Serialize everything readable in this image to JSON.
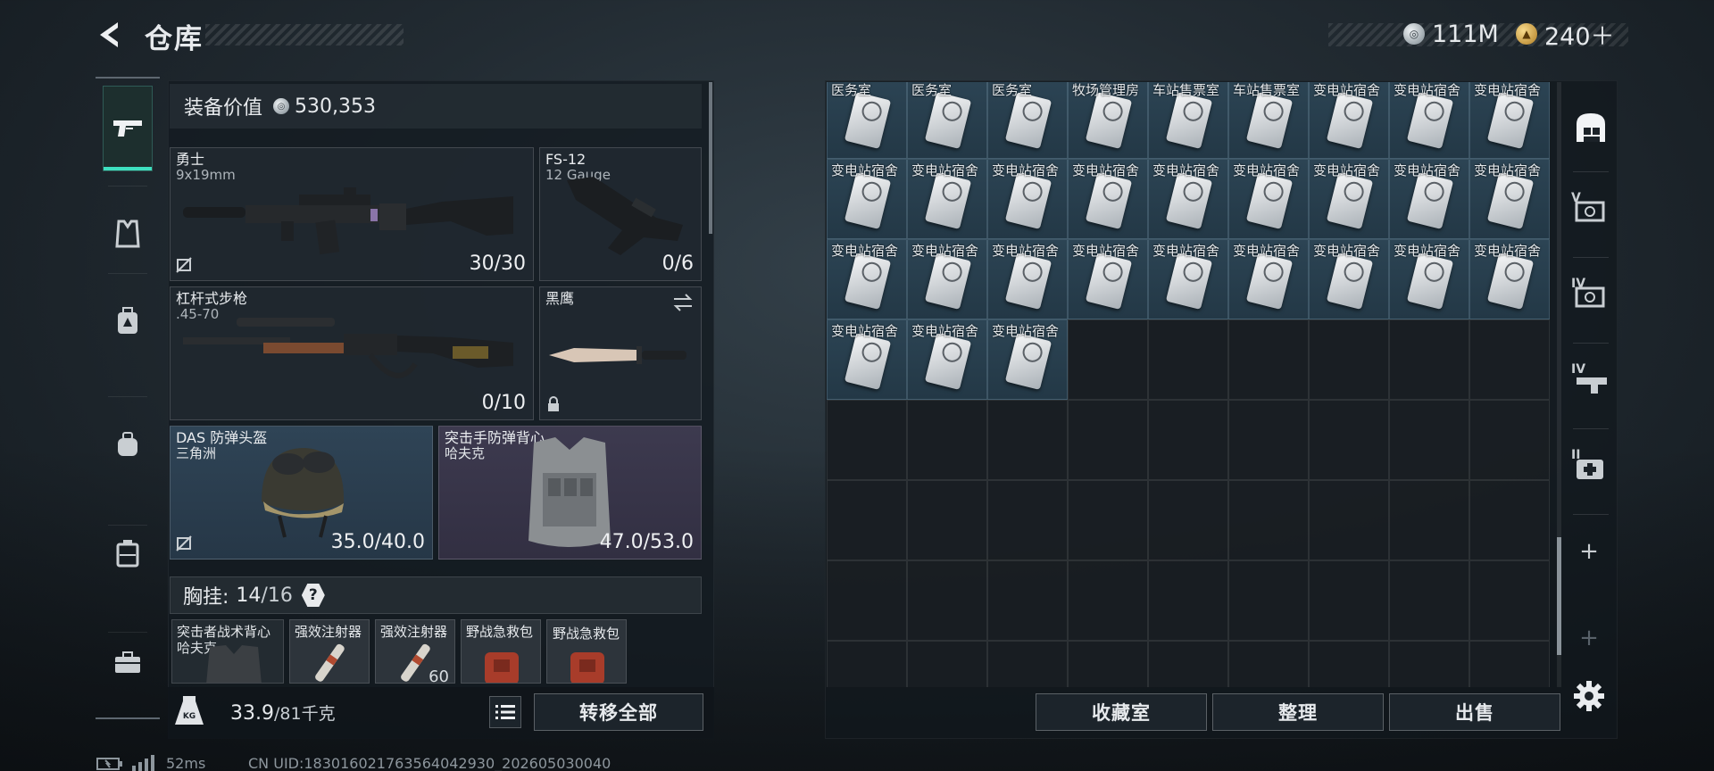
{
  "header": {
    "title": "仓库",
    "currency_silver": "111M",
    "currency_gold": "240＋"
  },
  "equipment": {
    "value_label": "装备价值",
    "value": "530,353",
    "primary": {
      "name": "勇士",
      "caliber": "9x19mm",
      "ammo": "30/30"
    },
    "secondary": {
      "name": "FS-12",
      "caliber": "12 Gauge",
      "ammo": "0/6"
    },
    "rifle": {
      "name": "杠杆式步枪",
      "caliber": ".45-70",
      "ammo": "0/10"
    },
    "melee": {
      "name": "黑鹰"
    },
    "helmet": {
      "name": "DAS 防弹头盔",
      "origin": "三角洲",
      "durability": "35.0/40.0"
    },
    "armor": {
      "name": "突击手防弹背心",
      "origin": "哈夫克",
      "durability": "47.0/53.0"
    },
    "chest_rig": {
      "label": "胸挂:",
      "used": "14",
      "capacity": "/16",
      "help": "?"
    },
    "rig_items": [
      {
        "name": "突击者战术背心",
        "sub": "哈夫克"
      },
      {
        "name": "强效注射器",
        "count": ""
      },
      {
        "name": "强效注射器",
        "count": "60"
      },
      {
        "name": "野战急救包"
      },
      {
        "name": "野战急救包"
      }
    ],
    "weight": "33.9",
    "weight_max": "/81千克",
    "transfer_all": "转移全部"
  },
  "storage": {
    "items": [
      "医务室",
      "医务室",
      "医务室",
      "牧场管理房",
      "车站售票室",
      "车站售票室",
      "变电站宿舍",
      "变电站宿舍",
      "变电站宿舍",
      "变电站宿舍",
      "变电站宿舍",
      "变电站宿舍",
      "变电站宿舍",
      "变电站宿舍",
      "变电站宿舍",
      "变电站宿舍",
      "变电站宿舍",
      "变电站宿舍",
      "变电站宿舍",
      "变电站宿舍",
      "变电站宿舍",
      "变电站宿舍",
      "变电站宿舍",
      "变电站宿舍",
      "变电站宿舍",
      "变电站宿舍",
      "变电站宿舍",
      "变电站宿舍",
      "变电站宿舍",
      "变电站宿舍"
    ],
    "side_tabs": [
      "",
      "V",
      "IV",
      "IV",
      "II"
    ],
    "buttons": {
      "collection": "收藏室",
      "sort": "整理",
      "sell": "出售"
    }
  },
  "status": {
    "ping": "52ms",
    "uid": "CN UID:183016021763564042930_202605030040"
  },
  "colors": {
    "accent": "#3ee0c0",
    "item_bg": "#2c4454"
  }
}
